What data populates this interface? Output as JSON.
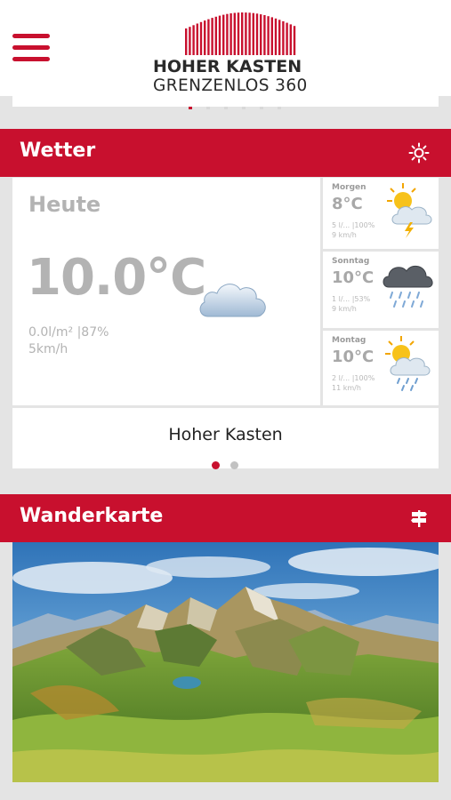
{
  "header": {
    "menu_icon": "hamburger-menu-icon",
    "logo_title": "HOHER KASTEN",
    "logo_subtitle": "GRENZENLOS 360"
  },
  "weather": {
    "section_title": "Wetter",
    "section_icon": "sun-icon",
    "today": {
      "label": "Heute",
      "temperature": "10.0°C",
      "precip_humidity": "0.0l/m² |87%",
      "wind": "5km/h",
      "icon": "cloud-icon"
    },
    "forecast": [
      {
        "day": "Morgen",
        "temperature": "8°C",
        "precip_humidity": "5 l/... |100%",
        "wind": "9 km/h",
        "icon": "sun-cloud-thunder-icon"
      },
      {
        "day": "Sonntag",
        "temperature": "10°C",
        "precip_humidity": "1 l/... |53%",
        "wind": "9 km/h",
        "icon": "dark-cloud-rain-icon"
      },
      {
        "day": "Montag",
        "temperature": "10°C",
        "precip_humidity": "2 l/... |100%",
        "wind": "11 km/h",
        "icon": "sun-cloud-rain-icon"
      }
    ],
    "location": "Hoher Kasten",
    "pager": {
      "count": 2,
      "active": 1
    }
  },
  "map_section": {
    "title": "Wanderkarte",
    "icon": "signpost-icon",
    "image": "panorama-map-image"
  },
  "colors": {
    "accent": "#c8102e",
    "background": "#e4e4e4",
    "card": "#ffffff",
    "muted_text": "#b3b3b3"
  }
}
